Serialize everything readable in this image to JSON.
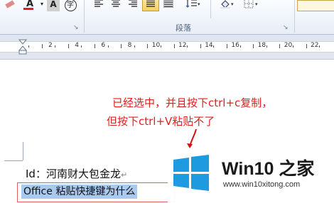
{
  "ribbon": {
    "font_color_glyph": "A",
    "char_shade_glyph": "A",
    "enclose_glyph": "字",
    "paragraph_group_label": "段落",
    "launcher_glyph": "↘"
  },
  "ruler": {
    "numbers": [
      "2",
      "4",
      "6",
      "8",
      "10",
      "12",
      "14",
      "16",
      "18",
      "20",
      "22"
    ]
  },
  "annotation": {
    "line1": "已经选中，并且按下ctrl+c复制，",
    "line2": "但按下ctrl+V粘贴不了",
    "color": "#e0201e"
  },
  "document": {
    "id_line": "Id：河南财大包金龙",
    "paragraph_mark": "↵",
    "selected_text": "Office 粘贴快捷键为什么",
    "selection_color": "#aac9ef"
  },
  "watermark": {
    "brand": "Win10 之家",
    "url": "www.win10xitong.com",
    "logo_color": "#1e9be0"
  }
}
